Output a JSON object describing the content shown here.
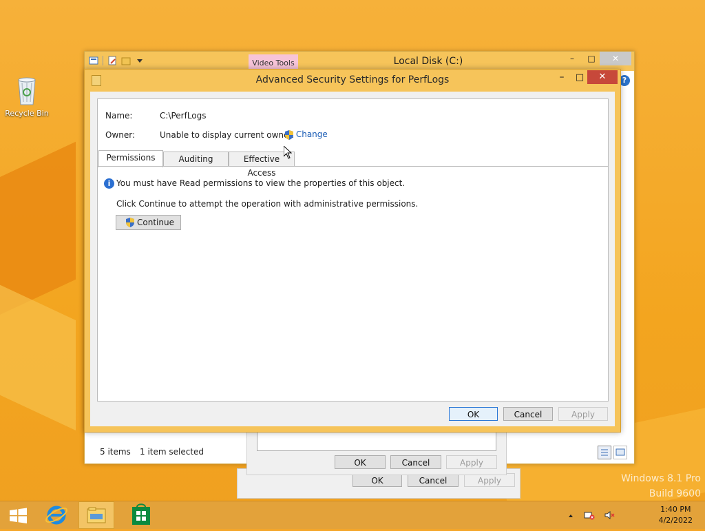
{
  "desktop": {
    "recycle_bin_label": "Recycle Bin",
    "watermark_line1": "Windows 8.1 Pro",
    "watermark_line2": "Build 9600"
  },
  "explorer": {
    "title": "Local Disk (C:)",
    "contextual_tab": "Video Tools",
    "status_items": "5 items",
    "status_selected": "1 item selected"
  },
  "properties_dialog": {
    "ok": "OK",
    "cancel": "Cancel",
    "apply": "Apply"
  },
  "dialog": {
    "title": "Advanced Security Settings for PerfLogs",
    "name_label": "Name:",
    "name_value": "C:\\PerfLogs",
    "owner_label": "Owner:",
    "owner_value": "Unable to display current owner.",
    "change_link": "Change",
    "tabs": [
      "Permissions",
      "Auditing",
      "Effective Access"
    ],
    "active_tab": "Permissions",
    "info_message": "You must have Read permissions to view the properties of this object.",
    "continue_prompt": "Click Continue to attempt the operation with administrative permissions.",
    "continue_button": "Continue",
    "ok": "OK",
    "cancel": "Cancel",
    "apply": "Apply"
  },
  "taskbar": {
    "time": "1:40 PM",
    "date": "4/2/2022"
  },
  "colors": {
    "desktop": "#f4a62a",
    "title_bar": "#f6c45a",
    "close_button": "#c7483a",
    "link": "#1a5cb5"
  }
}
